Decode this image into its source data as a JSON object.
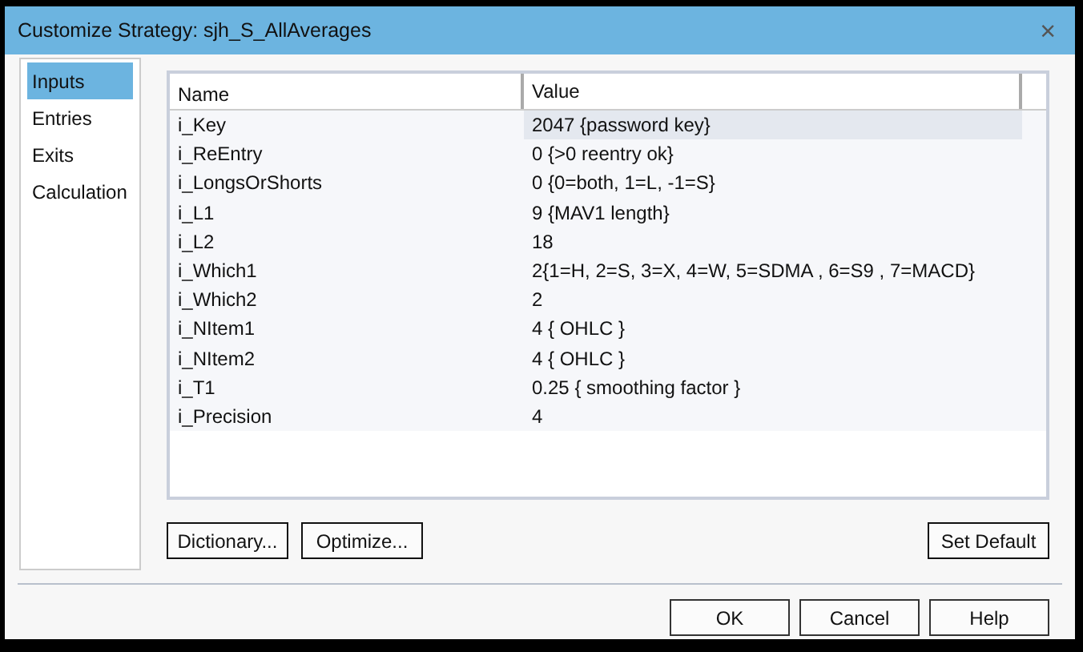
{
  "window": {
    "title": "Customize Strategy: sjh_S_AllAverages",
    "close": "×"
  },
  "sidebar": {
    "items": [
      {
        "label": "Inputs",
        "selected": true
      },
      {
        "label": "Entries",
        "selected": false
      },
      {
        "label": "Exits",
        "selected": false
      },
      {
        "label": "Calculation",
        "selected": false
      }
    ]
  },
  "table": {
    "columns": [
      "Name",
      "Value"
    ],
    "rows": [
      {
        "name": "i_Key",
        "value": "2047 {password key}",
        "selected": true
      },
      {
        "name": "i_ReEntry",
        "value": "0 {>0 reentry ok}",
        "selected": false
      },
      {
        "name": "i_LongsOrShorts",
        "value": "0 {0=both, 1=L, -1=S}",
        "selected": false
      },
      {
        "name": "i_L1",
        "value": "9 {MAV1 length}",
        "selected": false
      },
      {
        "name": "i_L2",
        "value": "18",
        "selected": false
      },
      {
        "name": "i_Which1",
        "value": "2{1=H, 2=S, 3=X, 4=W, 5=SDMA , 6=S9 , 7=MACD}",
        "selected": false
      },
      {
        "name": "i_Which2",
        "value": "2",
        "selected": false
      },
      {
        "name": "i_NItem1",
        "value": "4 { OHLC }",
        "selected": false
      },
      {
        "name": "i_NItem2",
        "value": "4 { OHLC }",
        "selected": false
      },
      {
        "name": "i_T1",
        "value": "0.25 { smoothing factor }",
        "selected": false
      },
      {
        "name": "i_Precision",
        "value": "4",
        "selected": false
      }
    ]
  },
  "panel_buttons": [
    "Dictionary...",
    "Optimize..."
  ],
  "set_default_button": "Set Default",
  "dialog_buttons": [
    "OK",
    "Cancel",
    "Help"
  ]
}
